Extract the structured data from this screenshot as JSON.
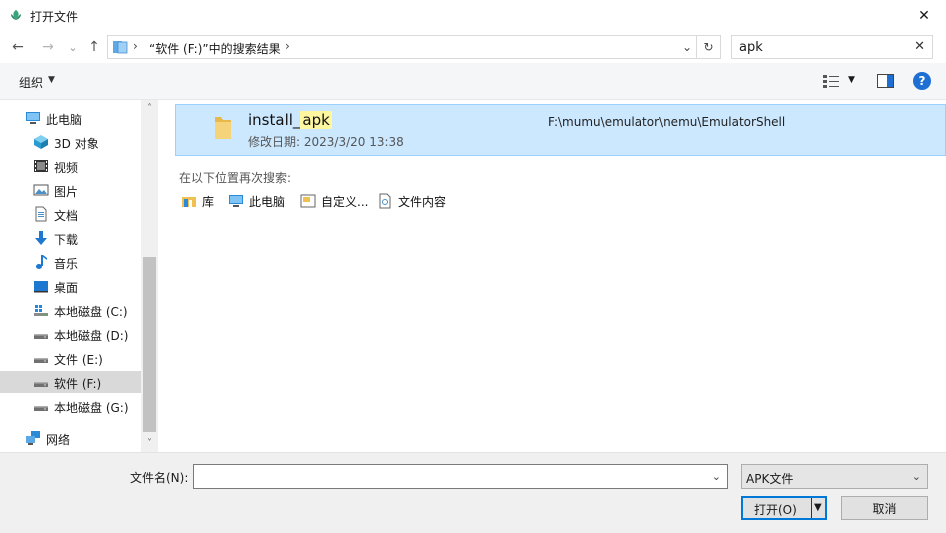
{
  "window": {
    "title": "打开文件",
    "close_glyph": "✕"
  },
  "nav": {
    "back_glyph": "←",
    "forward_glyph": "→",
    "recent_glyph": "⌄",
    "up_glyph": "↑",
    "address_sep": "›",
    "address_text": "“软件 (F:)”中的搜索结果",
    "address_sep2": "›",
    "address_drop": "⌄",
    "refresh_glyph": "↻",
    "search_value": "apk",
    "search_clear": "✕"
  },
  "toolbar": {
    "organize_label": "组织",
    "caret": "▼",
    "help": "?"
  },
  "sidebar": {
    "scroll_up": "˄",
    "scroll_down": "˅",
    "items": [
      {
        "label": "此电脑",
        "icon": "pc-icon"
      },
      {
        "label": "3D 对象",
        "icon": "3d-objects-icon"
      },
      {
        "label": "视频",
        "icon": "video-icon"
      },
      {
        "label": "图片",
        "icon": "pictures-icon"
      },
      {
        "label": "文档",
        "icon": "documents-icon"
      },
      {
        "label": "下载",
        "icon": "downloads-icon"
      },
      {
        "label": "音乐",
        "icon": "music-icon"
      },
      {
        "label": "桌面",
        "icon": "desktop-icon"
      },
      {
        "label": "本地磁盘 (C:)",
        "icon": "drive-windows-icon"
      },
      {
        "label": "本地磁盘 (D:)",
        "icon": "drive-icon"
      },
      {
        "label": "文件 (E:)",
        "icon": "drive-icon"
      },
      {
        "label": "软件 (F:)",
        "icon": "drive-icon"
      },
      {
        "label": "本地磁盘 (G:)",
        "icon": "drive-icon"
      },
      {
        "label": "网络",
        "icon": "network-icon"
      }
    ]
  },
  "result": {
    "name_prefix": "install_",
    "name_match": "apk",
    "meta": "修改日期: 2023/3/20 13:38",
    "path": "F:\\mumu\\emulator\\nemu\\EmulatorShell"
  },
  "search_again": {
    "label": "在以下位置再次搜索:",
    "items": [
      {
        "label": "库",
        "icon": "library-icon"
      },
      {
        "label": "此电脑",
        "icon": "pc-icon"
      },
      {
        "label": "自定义...",
        "icon": "custom-folder-icon"
      },
      {
        "label": "文件内容",
        "icon": "file-contents-icon"
      }
    ]
  },
  "footer": {
    "filename_label": "文件名(N):",
    "filename_value": "",
    "dropdown_glyph": "⌄",
    "filter_value": "APK文件",
    "open_label": "打开(O)",
    "open_caret": "▼",
    "cancel_label": "取消"
  },
  "colors": {
    "selection": "#cce8ff",
    "selection_border": "#99d1ff",
    "accent": "#0078d7",
    "help_blue": "#1e6fd4"
  }
}
